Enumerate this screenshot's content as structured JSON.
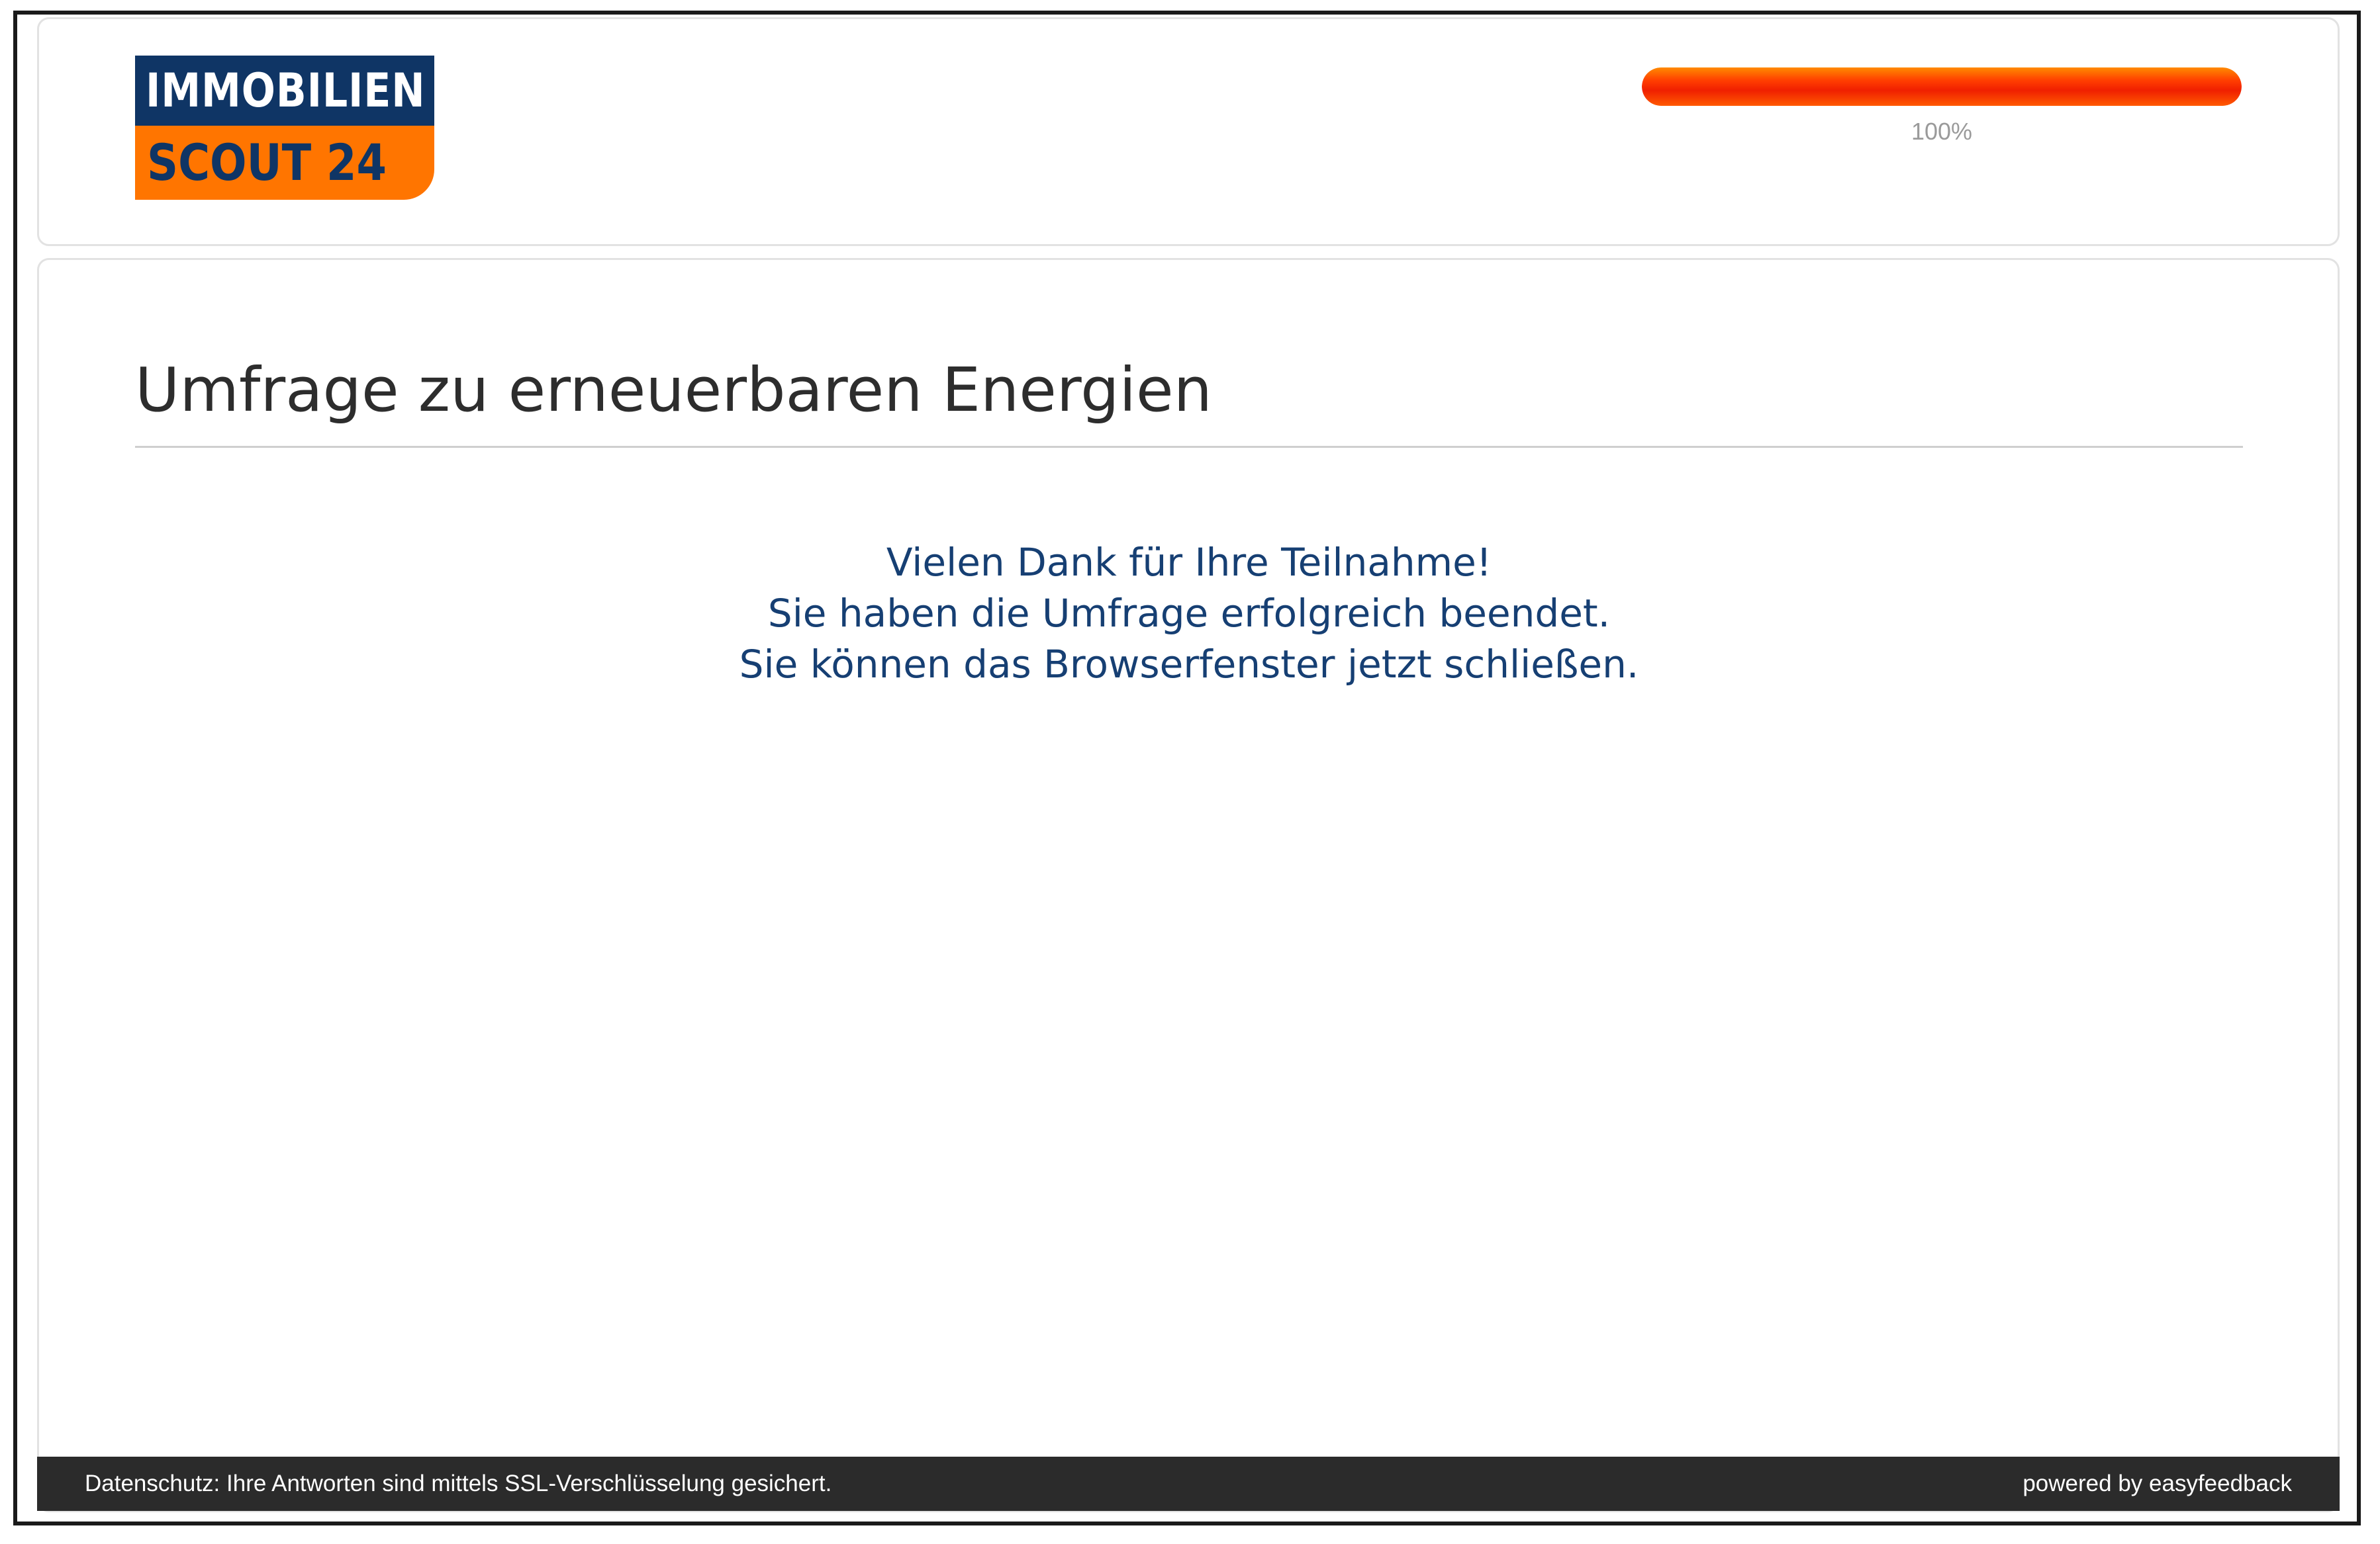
{
  "header": {
    "logo": {
      "line1": "IMMOBILIEN",
      "line2": "SCOUT 24",
      "colors": {
        "navy": "#0f3565",
        "orange": "#ff7500"
      }
    },
    "progress": {
      "value": 100,
      "label": "100%",
      "color": "#ff3c00"
    }
  },
  "main": {
    "title": "Umfrage zu erneuerbaren Energien",
    "message_lines": [
      "Vielen Dank für Ihre Teilnahme!",
      "Sie haben die Umfrage erfolgreich beendet.",
      "Sie können das Browserfenster jetzt schließen."
    ],
    "message_color": "#163f73"
  },
  "footer": {
    "privacy_text": "Datenschutz: Ihre Antworten sind mittels SSL-Verschlüsselung gesichert.",
    "powered_by": "powered by easyfeedback"
  }
}
